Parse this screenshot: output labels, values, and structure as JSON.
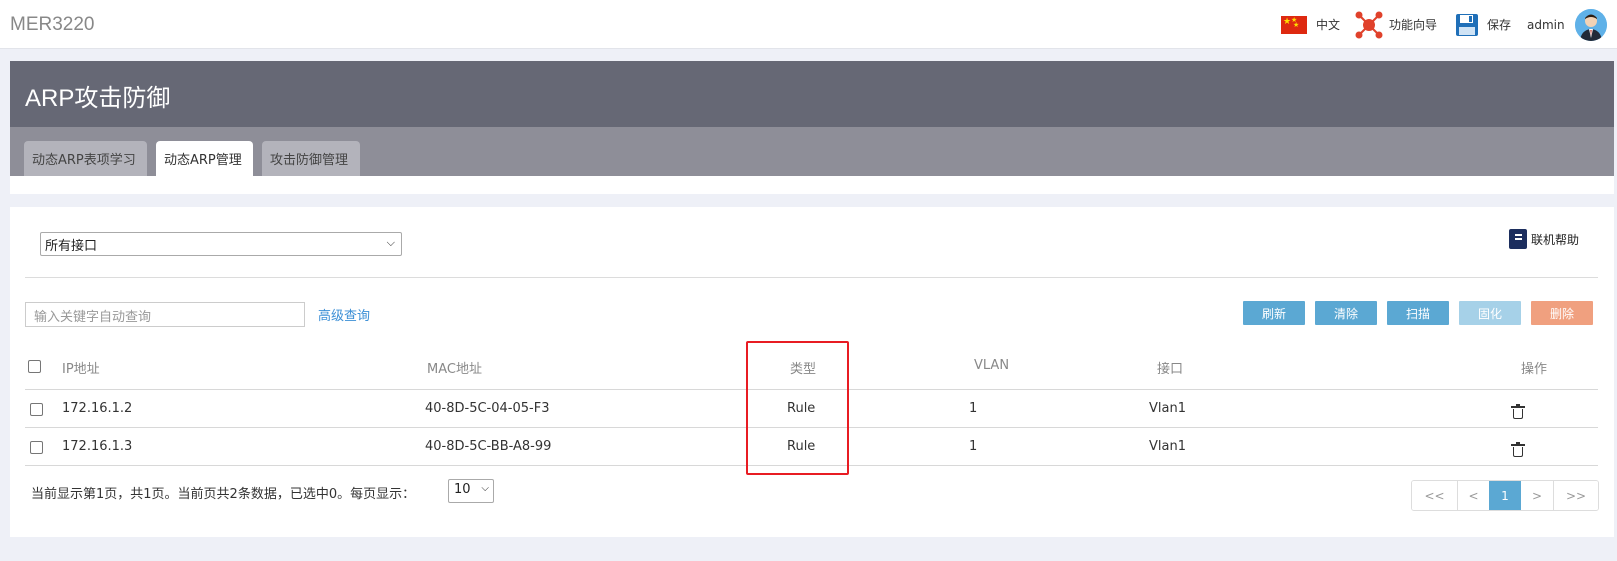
{
  "topbar": {
    "brand": "MER3220",
    "language": "中文",
    "wizard": "功能向导",
    "save": "保存",
    "user": "admin"
  },
  "page": {
    "title": "ARP攻击防御",
    "tabs": [
      {
        "label": "动态ARP表项学习",
        "active": false
      },
      {
        "label": "动态ARP管理",
        "active": true
      },
      {
        "label": "攻击防御管理",
        "active": false
      }
    ]
  },
  "filter": {
    "interface_selected": "所有接口",
    "help": "联机帮助"
  },
  "search": {
    "placeholder": "输入关键字自动查询",
    "advanced": "高级查询"
  },
  "buttons": {
    "refresh": "刷新",
    "clear": "清除",
    "scan": "扫描",
    "solidify": "固化",
    "delete": "删除"
  },
  "colors": {
    "btn_blue": "#5ba8d3",
    "btn_disabled": "#a6d1e8",
    "btn_delete": "#f0a07f",
    "highlight": "#e81c23"
  },
  "table": {
    "headers": [
      "IP地址",
      "MAC地址",
      "类型",
      "VLAN",
      "接口",
      "操作"
    ],
    "rows": [
      {
        "ip": "172.16.1.2",
        "mac": "40-8D-5C-04-05-F3",
        "type": "Rule",
        "vlan": "1",
        "iface": "Vlan1"
      },
      {
        "ip": "172.16.1.3",
        "mac": "40-8D-5C-BB-A8-99",
        "type": "Rule",
        "vlan": "1",
        "iface": "Vlan1"
      }
    ]
  },
  "footer": {
    "status": "当前显示第1页，共1页。当前页共2条数据，已选中0。每页显示：",
    "page_size": "10",
    "pager": {
      "first": "<<",
      "prev": "<",
      "current": "1",
      "next": ">",
      "last": ">>"
    }
  }
}
